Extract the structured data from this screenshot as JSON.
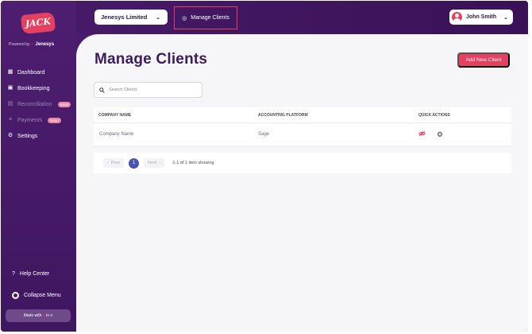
{
  "brand": {
    "logo_text": "JACK",
    "powered_by": "Powered by",
    "powered_brand": "Jenesys"
  },
  "topbar": {
    "company_select": "Jenesys Limited",
    "manage_clients_link": "Manage Clients",
    "user_name": "John Smith"
  },
  "sidebar": {
    "items": [
      {
        "label": "Dashboard",
        "icon": "grid-icon",
        "badge": ""
      },
      {
        "label": "Bookkeeping",
        "icon": "book-icon",
        "badge": ""
      },
      {
        "label": "Reconciliation",
        "icon": "reconcile-icon",
        "badge": "Soon"
      },
      {
        "label": "Payments",
        "icon": "payments-icon",
        "badge": "Soon"
      },
      {
        "label": "Settings",
        "icon": "gear-icon",
        "badge": ""
      }
    ],
    "help_center": "Help Center",
    "collapse_menu": "Collapse Menu",
    "made_with": "Made with",
    "made_in": "in"
  },
  "main": {
    "title": "Manage Clients",
    "add_button": "Add New Client",
    "search_placeholder": "Search Clients",
    "table": {
      "headers": [
        "COMPANY NAME",
        "ACCOUNTING PLATFORM",
        "QUICK ACTIONS"
      ],
      "rows": [
        {
          "company": "Company Name",
          "platform": "Sage"
        }
      ]
    },
    "pagination": {
      "prev": "Prev",
      "next": "Next",
      "current_page": "1",
      "info": "1-1 of 1 item showing"
    }
  },
  "colors": {
    "accent": "#e4405f",
    "sidebar": "#4a1c6b",
    "title": "#3a1d5c",
    "page_active": "#4953b0"
  }
}
